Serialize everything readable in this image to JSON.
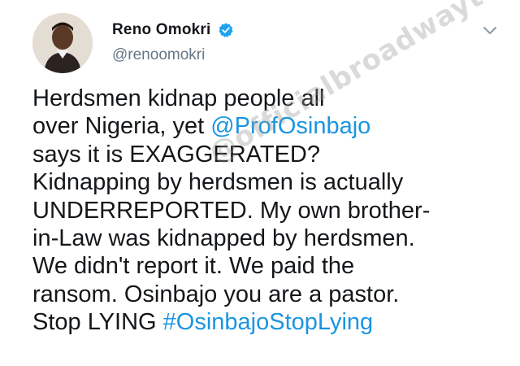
{
  "tweet": {
    "author": {
      "display_name": "Reno Omokri",
      "handle": "@renoomokri",
      "verified": true,
      "avatar_icon": "avatar-photo"
    },
    "menu_icon": "chevron-down-icon",
    "lines": [
      {
        "pre": "Herdsmen kidnap people all",
        "mention": "",
        "post": ""
      },
      {
        "pre": "over Nigeria, yet ",
        "mention": "@ProfOsinbajo",
        "post": ""
      },
      {
        "pre": "says it is EXAGGERATED?",
        "mention": "",
        "post": ""
      },
      {
        "pre": "Kidnapping by herdsmen is actually",
        "mention": "",
        "post": ""
      },
      {
        "pre": "UNDERREPORTED. My own brother-",
        "mention": "",
        "post": ""
      },
      {
        "pre": "in-Law was kidnapped by herdsmen.",
        "mention": "",
        "post": ""
      },
      {
        "pre": "We didn't report it. We paid the",
        "mention": "",
        "post": ""
      },
      {
        "pre": "ransom. Osinbajo you are a pastor.",
        "mention": "",
        "post": ""
      },
      {
        "pre": "Stop LYING ",
        "mention": "#OsinbajoStopLying",
        "post": ""
      }
    ]
  },
  "watermark": "@officialbroadwaytv",
  "colors": {
    "link": "#1b95e0",
    "verified": "#1da1f2",
    "handle": "#657786",
    "text": "#14171a"
  }
}
